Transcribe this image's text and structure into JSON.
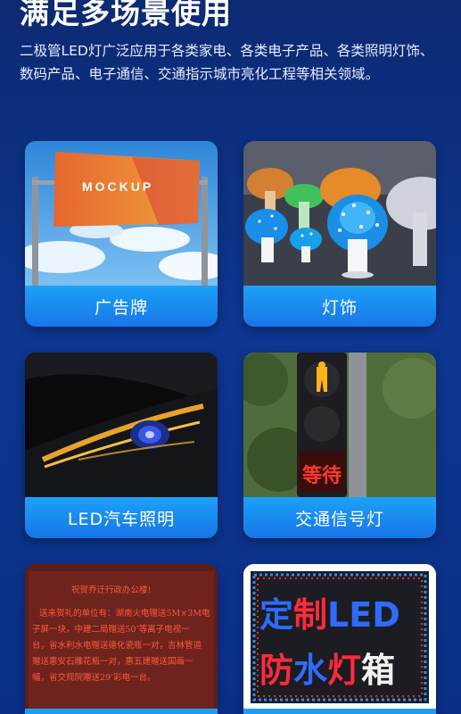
{
  "header": {
    "title": "满足多场景使用",
    "description": "二极管LED灯广泛应用于各类家电、各类电子产品、各类照明灯饰、数码产品、电子通信、交通指示城市亮化工程等相关领域。"
  },
  "cards": [
    {
      "label": "广告牌",
      "image_text": "MOCKUP"
    },
    {
      "label": "灯饰"
    },
    {
      "label": "LED汽车照明"
    },
    {
      "label": "交通信号灯",
      "image_text": "等待"
    },
    {
      "label": "",
      "image_text": {
        "title": "祝贺乔迁行政办公楼!",
        "lines": [
          "送来贺礼的单位有：湖南火电赠送5M×3M电",
          "子屏一块，中建二局赠送50’等离子电视一",
          "台，省水利水电赠送德化瓷瓶一对，吉林管道",
          "赠送惠安石雕花瓶一对，惠五建赠送国画一",
          "幅，省交规院赠送29’彩电一台。"
        ]
      }
    },
    {
      "label": "",
      "image_text": {
        "line1": "定制LED",
        "line2": "防水灯箱"
      }
    }
  ]
}
